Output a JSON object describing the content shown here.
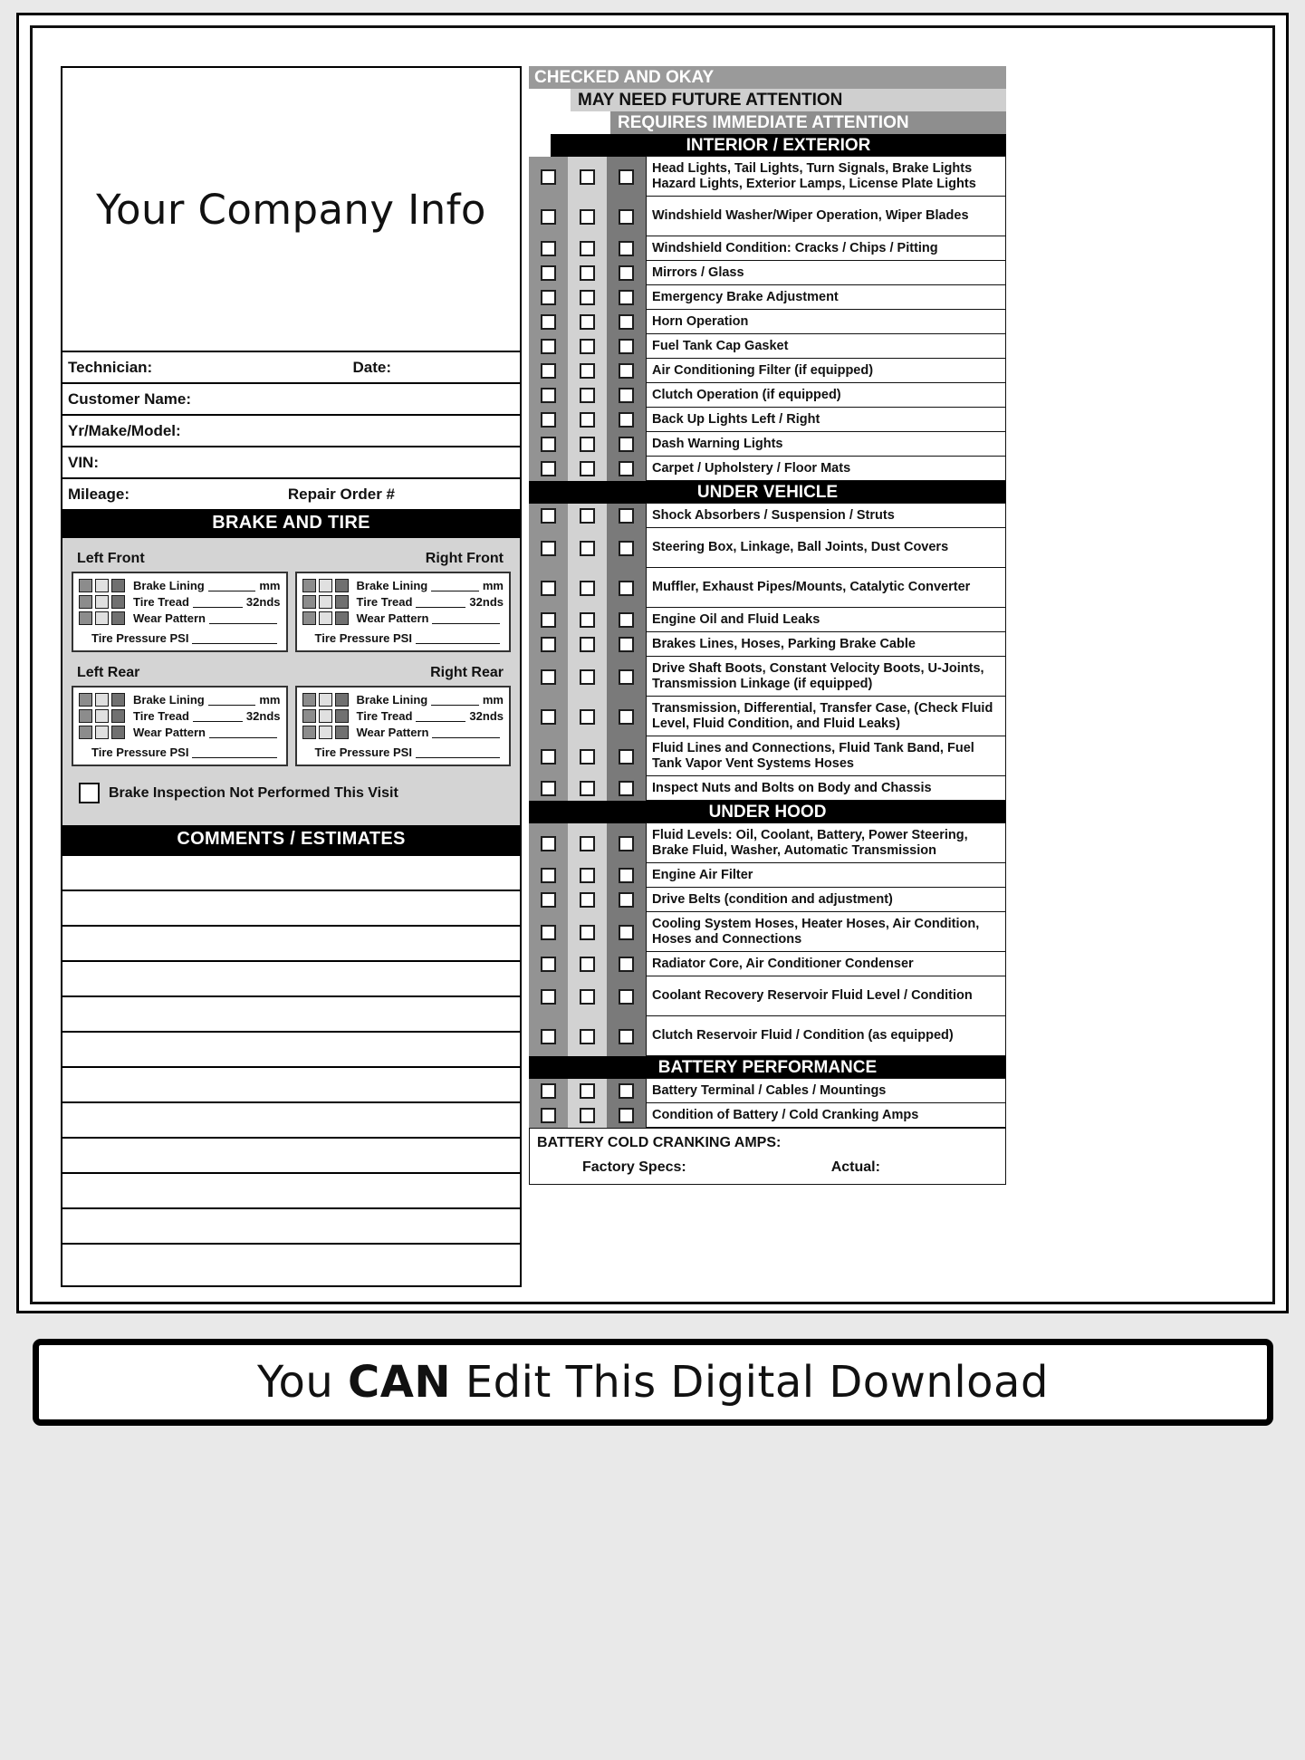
{
  "document": {
    "company_title": "Your Company Info",
    "banner_prefix": "You ",
    "banner_bold": "CAN",
    "banner_suffix": " Edit This Digital Download"
  },
  "customer_fields": {
    "technician": "Technician:",
    "date": "Date:",
    "customer_name": "Customer Name:",
    "year_make_model": "Yr/Make/Model:",
    "vin": "VIN:",
    "mileage": "Mileage:",
    "repair_order": "Repair Order #"
  },
  "brake_tire": {
    "header": "BRAKE AND TIRE",
    "wheels": [
      {
        "left_label": "Left Front",
        "right_label": "Right Front"
      },
      {
        "left_label": "Left Rear",
        "right_label": "Right Rear"
      }
    ],
    "measure_rows": [
      {
        "label": "Brake Lining",
        "unit": "mm"
      },
      {
        "label": "Tire Tread",
        "unit": "32nds"
      },
      {
        "label": "Wear Pattern",
        "unit": ""
      }
    ],
    "psi_label": "Tire Pressure PSI",
    "not_performed": "Brake Inspection Not Performed This Visit"
  },
  "comments": {
    "header": "COMMENTS / ESTIMATES",
    "line_count": 12
  },
  "legend": [
    {
      "label": "CHECKED AND OKAY",
      "color": "#9a9a9a"
    },
    {
      "label": "MAY NEED FUTURE ATTENTION",
      "color": "#cfcfcf"
    },
    {
      "label": "REQUIRES IMMEDIATE ATTENTION",
      "color": "#8e8e8e"
    }
  ],
  "sections": [
    {
      "title": "INTERIOR / EXTERIOR",
      "items": [
        "Head Lights, Tail Lights, Turn Signals, Brake Lights Hazard Lights, Exterior Lamps, License Plate Lights",
        "Windshield Washer/Wiper Operation, Wiper Blades",
        "Windshield Condition: Cracks / Chips / Pitting",
        "Mirrors / Glass",
        "Emergency Brake Adjustment",
        "Horn Operation",
        "Fuel Tank Cap Gasket",
        "Air Conditioning Filter (if equipped)",
        "Clutch Operation (if equipped)",
        "Back Up Lights Left / Right",
        "Dash Warning Lights",
        "Carpet / Upholstery / Floor Mats"
      ]
    },
    {
      "title": "UNDER VEHICLE",
      "items": [
        "Shock Absorbers / Suspension / Struts",
        "Steering Box, Linkage, Ball Joints, Dust Covers",
        "Muffler, Exhaust Pipes/Mounts, Catalytic Converter",
        "Engine Oil and Fluid Leaks",
        "Brakes Lines, Hoses, Parking Brake Cable",
        "Drive Shaft Boots, Constant Velocity Boots, U-Joints, Transmission Linkage (if equipped)",
        "Transmission, Differential, Transfer Case, (Check Fluid Level, Fluid Condition, and Fluid Leaks)",
        "Fluid Lines and Connections, Fluid Tank Band, Fuel Tank Vapor Vent Systems Hoses",
        "Inspect Nuts and Bolts on Body and Chassis"
      ]
    },
    {
      "title": "UNDER HOOD",
      "items": [
        "Fluid Levels: Oil, Coolant, Battery, Power Steering, Brake Fluid, Washer, Automatic Transmission",
        "Engine Air Filter",
        "Drive Belts (condition and adjustment)",
        "Cooling System Hoses, Heater Hoses, Air Condition, Hoses and Connections",
        "Radiator Core, Air Conditioner Condenser",
        "Coolant Recovery Reservoir Fluid Level / Condition",
        "Clutch Reservoir Fluid / Condition (as equipped)"
      ]
    },
    {
      "title": "BATTERY PERFORMANCE",
      "items": [
        "Battery Terminal / Cables / Mountings",
        "Condition of Battery / Cold Cranking Amps"
      ]
    }
  ],
  "battery_cca": {
    "title": "BATTERY COLD CRANKING AMPS:",
    "factory": "Factory Specs:",
    "actual": "Actual:"
  }
}
